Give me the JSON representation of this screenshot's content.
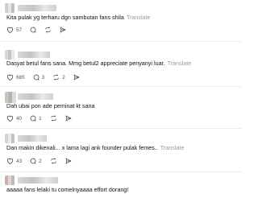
{
  "translate_label": "Translate",
  "comments": [
    {
      "text": "Kita pulak yg terharu dgn sambutan fans shila",
      "has_translate": true,
      "likes": "57",
      "reposts": "",
      "shares": ""
    },
    {
      "text": "Dasyat betul fans sana. Mmg betul2 appreciate penyanyi luar.",
      "has_translate": true,
      "likes": "685",
      "reposts": "3",
      "shares": "2"
    },
    {
      "text": "Dah ubai pon ade peminat kt sana",
      "has_translate": false,
      "likes": "40",
      "reposts": "1",
      "shares": ""
    },
    {
      "text": "Dan makin dikenali... x lama lagi ank founder pulak femes..",
      "has_translate": true,
      "likes": "43",
      "reposts": "2",
      "shares": ""
    },
    {
      "text": "aaaaa fans lelaki tu comelnyaaaa effort dorang!",
      "has_translate": false,
      "likes": "",
      "reposts": "",
      "shares": ""
    }
  ],
  "icons": {
    "like": "heart-icon",
    "comment": "comment-bubble-icon",
    "repost": "repost-arrows-icon",
    "share": "send-paper-plane-icon"
  }
}
